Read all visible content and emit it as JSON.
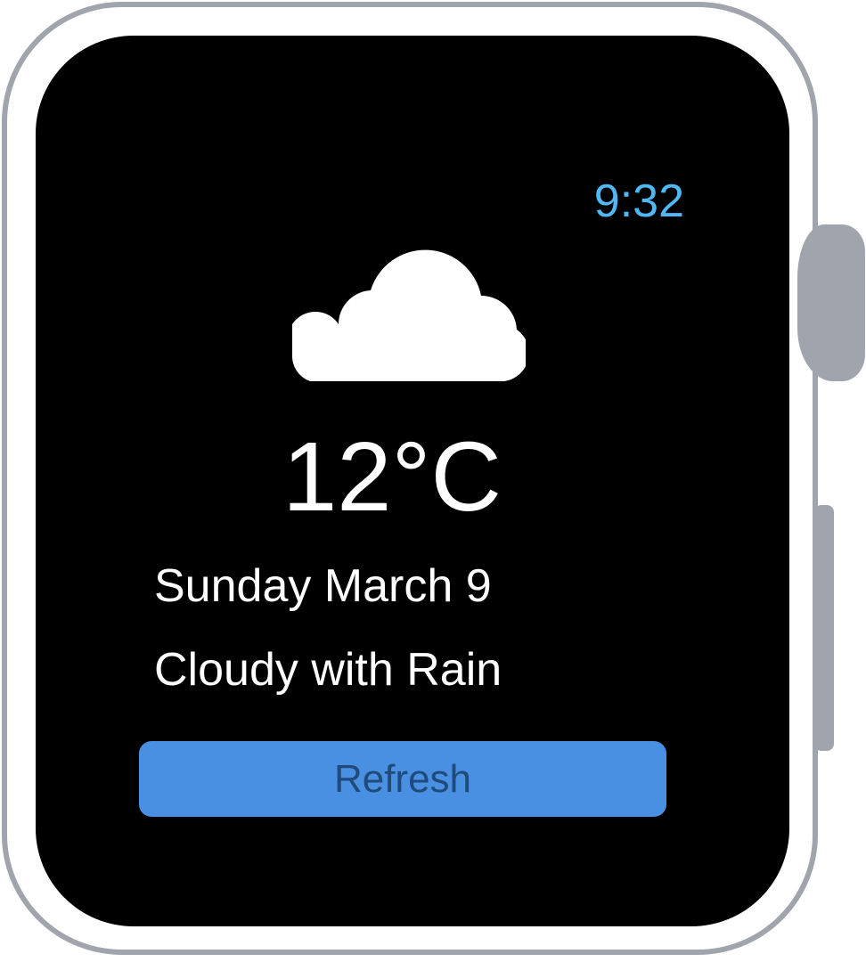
{
  "status": {
    "time": "9:32",
    "time_color": "#4fb8f5"
  },
  "weather": {
    "icon": "cloud-icon",
    "temperature": "12°C",
    "date": "Sunday March 9",
    "condition": "Cloudy with Rain"
  },
  "actions": {
    "refresh_label": "Refresh",
    "refresh_color": "#4a90e2"
  }
}
